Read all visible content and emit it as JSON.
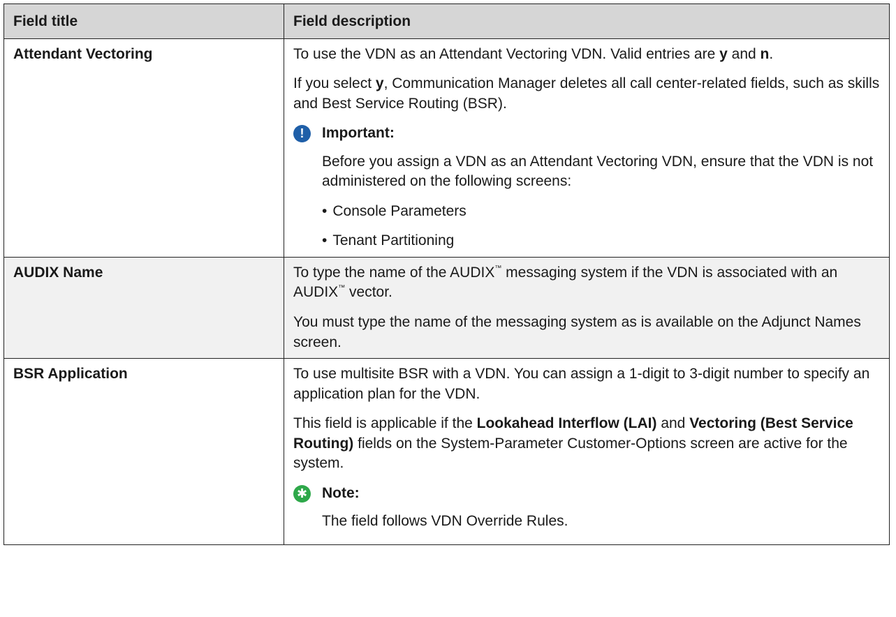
{
  "table": {
    "header": {
      "col1": "Field title",
      "col2": "Field description"
    },
    "rows": [
      {
        "title": "Attendant Vectoring",
        "p1_a": "To use the VDN as an Attendant Vectoring VDN. Valid entries are ",
        "p1_b1": "y",
        "p1_c": " and ",
        "p1_b2": "n",
        "p1_d": ".",
        "p2_a": "If you select ",
        "p2_b": "y",
        "p2_c": ", Communication Manager deletes all call center-related fields, such as skills and Best Service Routing (BSR).",
        "callout": {
          "label": "Important:",
          "icon": "!",
          "color": "#1f5fa8",
          "text": "Before you assign a VDN as an Attendant Vectoring VDN, ensure that the VDN is not administered on the following screens:",
          "bullets": [
            "Console Parameters",
            "Tenant Partitioning"
          ],
          "bullet_char": "•"
        }
      },
      {
        "title": "AUDIX Name",
        "p1_a": "To type the name of the AUDIX",
        "tm": "™",
        "p1_b": " messaging system if the VDN is associated with an AUDIX",
        "p1_c": " vector.",
        "p2": "You must type the name of the messaging system as is available on the Adjunct Names screen."
      },
      {
        "title": "BSR Application",
        "p1": "To use multisite BSR with a VDN. You can assign a 1-digit to 3-digit number to specify an application plan for the VDN.",
        "p2_a": "This field is applicable if the ",
        "p2_b1": "Lookahead Interflow (LAI)",
        "p2_c": " and ",
        "p2_b2": "Vectoring (Best Service Routing)",
        "p2_d": " fields on the System-Parameter Customer-Options screen are active for the system.",
        "callout": {
          "label": "Note:",
          "icon": "✱",
          "color": "#2ea84a",
          "text": "The field follows VDN Override Rules."
        }
      }
    ]
  }
}
